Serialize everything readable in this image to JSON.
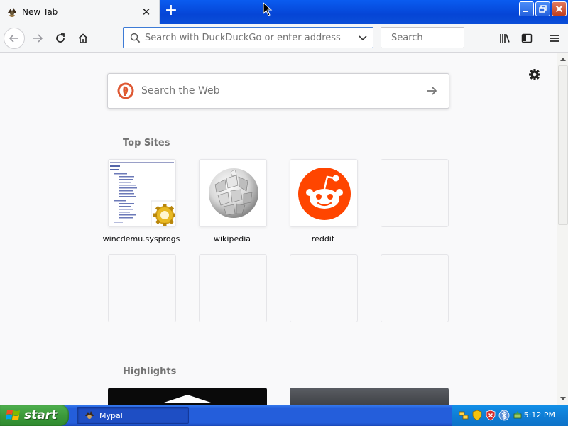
{
  "window": {
    "tab_title": "New Tab",
    "new_tab_symbol": "+"
  },
  "toolbar": {
    "url_placeholder": "Search with DuckDuckGo or enter address",
    "search_placeholder": "Search"
  },
  "newtab": {
    "web_search_placeholder": "Search the Web",
    "top_sites_title": "Top Sites",
    "highlights_title": "Highlights",
    "top_sites": [
      {
        "label": "wincdemu.sysprogs",
        "icon": "wincdemu-thumbnail"
      },
      {
        "label": "wikipedia",
        "icon": "wikipedia-globe-icon"
      },
      {
        "label": "reddit",
        "icon": "reddit-alien-icon"
      }
    ],
    "empty_tile_count": 5
  },
  "taskbar": {
    "start_label": "start",
    "task_label": "Mypal",
    "clock": "5:12 PM"
  },
  "colors": {
    "title_blue": "#0545d6",
    "toolbar_bg": "#f5f6f7",
    "content_bg": "#f9f9fa",
    "reddit_orange": "#ff4500",
    "taskbar_blue": "#245edb",
    "start_green": "#3c9a3b"
  }
}
